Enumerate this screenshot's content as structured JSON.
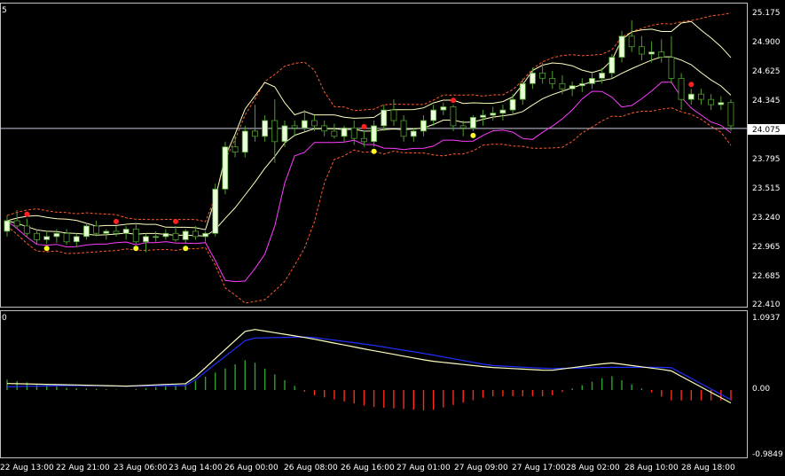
{
  "colors": {
    "background": "#000000",
    "frame": "#c0c0c0",
    "candle_body": "#e8ffd8",
    "candle_outline": "#4f9e2e",
    "bb_outer": "#ff5a2a",
    "bb_inner": "#ffffc0",
    "ma_magenta": "#ff3cff",
    "hline": "#c8c8d8",
    "dot_red": "#ff2020",
    "dot_yellow": "#ffff20",
    "osc_main": "#ffffc0",
    "osc_signal": "#2030ff",
    "hist_pos": "#2da02d",
    "hist_neg": "#ff2a1a",
    "text": "#ffffff"
  },
  "main_panel": {
    "corner_label": "5",
    "price_labels": [
      "25.175",
      "24.900",
      "24.625",
      "24.345",
      "24.075",
      "23.795",
      "23.515",
      "23.240",
      "22.965",
      "22.685",
      "22.410"
    ],
    "current_price": "24.075"
  },
  "osc_panel": {
    "corner_label": "0",
    "labels": [
      "1.0937",
      "0.00",
      "-0.9849"
    ]
  },
  "time_labels": [
    "22 Aug 13:00",
    "22 Aug 21:00",
    "23 Aug 06:00",
    "23 Aug 14:00",
    "26 Aug 00:00",
    "26 Aug 08:00",
    "26 Aug 16:00",
    "27 Aug 01:00",
    "27 Aug 09:00",
    "27 Aug 17:00",
    "28 Aug 02:00",
    "28 Aug 10:00",
    "28 Aug 18:00"
  ],
  "chart_data": [
    {
      "type": "candlestick",
      "y_range": [
        22.41,
        25.175
      ],
      "series": [
        {
          "values": [
            [
              23.1,
              23.25,
              23.05,
              23.2
            ],
            [
              23.2,
              23.3,
              23.12,
              23.15
            ],
            [
              23.15,
              23.22,
              23.05,
              23.08
            ],
            [
              23.08,
              23.12,
              22.98,
              23.02
            ],
            [
              23.02,
              23.1,
              22.98,
              23.05
            ],
            [
              23.05,
              23.12,
              22.99,
              23.08
            ],
            [
              23.08,
              23.12,
              22.97,
              23.0
            ],
            [
              23.0,
              23.08,
              22.95,
              23.05
            ],
            [
              23.05,
              23.18,
              23.02,
              23.15
            ],
            [
              23.15,
              23.2,
              23.05,
              23.08
            ],
            [
              23.08,
              23.12,
              23.02,
              23.1
            ],
            [
              23.1,
              23.15,
              23.05,
              23.08
            ],
            [
              23.08,
              23.15,
              23.02,
              23.12
            ],
            [
              23.12,
              23.18,
              22.98,
              23.0
            ],
            [
              23.0,
              23.08,
              22.9,
              23.05
            ],
            [
              23.05,
              23.1,
              23.0,
              23.05
            ],
            [
              23.05,
              23.12,
              23.02,
              23.08
            ],
            [
              23.08,
              23.15,
              23.0,
              23.02
            ],
            [
              23.02,
              23.12,
              22.98,
              23.1
            ],
            [
              23.1,
              23.15,
              23.02,
              23.05
            ],
            [
              23.05,
              23.1,
              23.0,
              23.08
            ],
            [
              23.08,
              23.55,
              23.05,
              23.5
            ],
            [
              23.5,
              23.95,
              23.45,
              23.9
            ],
            [
              23.9,
              24.0,
              23.8,
              23.85
            ],
            [
              23.85,
              24.1,
              23.8,
              24.05
            ],
            [
              24.05,
              24.3,
              23.95,
              24.0
            ],
            [
              24.0,
              24.2,
              23.95,
              24.15
            ],
            [
              24.15,
              24.35,
              23.75,
              23.95
            ],
            [
              23.95,
              24.15,
              23.9,
              24.1
            ],
            [
              24.1,
              24.15,
              24.0,
              24.08
            ],
            [
              24.08,
              24.25,
              24.05,
              24.15
            ],
            [
              24.15,
              24.2,
              24.05,
              24.1
            ],
            [
              24.1,
              24.15,
              24.0,
              24.05
            ],
            [
              24.05,
              24.12,
              23.98,
              24.0
            ],
            [
              24.0,
              24.1,
              23.95,
              24.08
            ],
            [
              24.08,
              24.15,
              23.92,
              23.98
            ],
            [
              23.98,
              24.05,
              23.9,
              23.95
            ],
            [
              23.95,
              24.15,
              23.9,
              24.1
            ],
            [
              24.1,
              24.3,
              24.05,
              24.25
            ],
            [
              24.25,
              24.35,
              24.1,
              24.15
            ],
            [
              24.15,
              24.2,
              23.95,
              24.0
            ],
            [
              24.0,
              24.08,
              23.95,
              24.05
            ],
            [
              24.05,
              24.2,
              24.0,
              24.15
            ],
            [
              24.15,
              24.3,
              24.1,
              24.25
            ],
            [
              24.25,
              24.32,
              24.2,
              24.28
            ],
            [
              24.28,
              24.3,
              24.05,
              24.1
            ],
            [
              24.1,
              24.15,
              24.0,
              24.08
            ],
            [
              24.08,
              24.2,
              24.05,
              24.18
            ],
            [
              24.18,
              24.25,
              24.1,
              24.2
            ],
            [
              24.2,
              24.28,
              24.15,
              24.22
            ],
            [
              24.22,
              24.3,
              24.15,
              24.25
            ],
            [
              24.25,
              24.4,
              24.2,
              24.35
            ],
            [
              24.35,
              24.55,
              24.3,
              24.5
            ],
            [
              24.5,
              24.65,
              24.45,
              24.6
            ],
            [
              24.6,
              24.7,
              24.5,
              24.55
            ],
            [
              24.55,
              24.62,
              24.45,
              24.5
            ],
            [
              24.5,
              24.58,
              24.4,
              24.45
            ],
            [
              24.45,
              24.52,
              24.38,
              24.48
            ],
            [
              24.48,
              24.55,
              24.42,
              24.5
            ],
            [
              24.5,
              24.6,
              24.45,
              24.55
            ],
            [
              24.55,
              24.65,
              24.5,
              24.6
            ],
            [
              24.6,
              24.78,
              24.55,
              24.75
            ],
            [
              24.75,
              25.0,
              24.7,
              24.95
            ],
            [
              24.95,
              25.1,
              24.8,
              24.85
            ],
            [
              24.85,
              24.95,
              24.72,
              24.78
            ],
            [
              24.78,
              24.9,
              24.7,
              24.8
            ],
            [
              24.8,
              24.92,
              24.7,
              24.75
            ],
            [
              24.75,
              24.95,
              24.5,
              24.55
            ],
            [
              24.55,
              24.6,
              24.25,
              24.35
            ],
            [
              24.35,
              24.45,
              24.3,
              24.4
            ],
            [
              24.4,
              24.45,
              24.3,
              24.35
            ],
            [
              24.35,
              24.4,
              24.25,
              24.3
            ],
            [
              24.3,
              24.38,
              24.25,
              24.32
            ],
            [
              24.32,
              24.35,
              24.05,
              24.1
            ]
          ]
        }
      ]
    },
    {
      "type": "line",
      "x": [
        "22 Aug 13:00",
        "22 Aug 21:00",
        "23 Aug 06:00",
        "23 Aug 14:00",
        "26 Aug 00:00",
        "26 Aug 08:00",
        "26 Aug 16:00",
        "27 Aug 01:00",
        "27 Aug 09:00",
        "27 Aug 17:00",
        "28 Aug 02:00",
        "28 Aug 10:00",
        "28 Aug 18:00"
      ],
      "y_range": [
        -0.9849,
        1.0937
      ],
      "series": [
        {
          "values": [
            0.1,
            0.08,
            0.06,
            0.1,
            0.95,
            0.8,
            0.62,
            0.45,
            0.35,
            0.3,
            0.42,
            0.3,
            -0.2
          ]
        },
        {
          "values": [
            0.05,
            0.07,
            0.06,
            0.07,
            0.8,
            0.82,
            0.7,
            0.55,
            0.38,
            0.33,
            0.35,
            0.35,
            -0.15
          ]
        }
      ]
    }
  ]
}
